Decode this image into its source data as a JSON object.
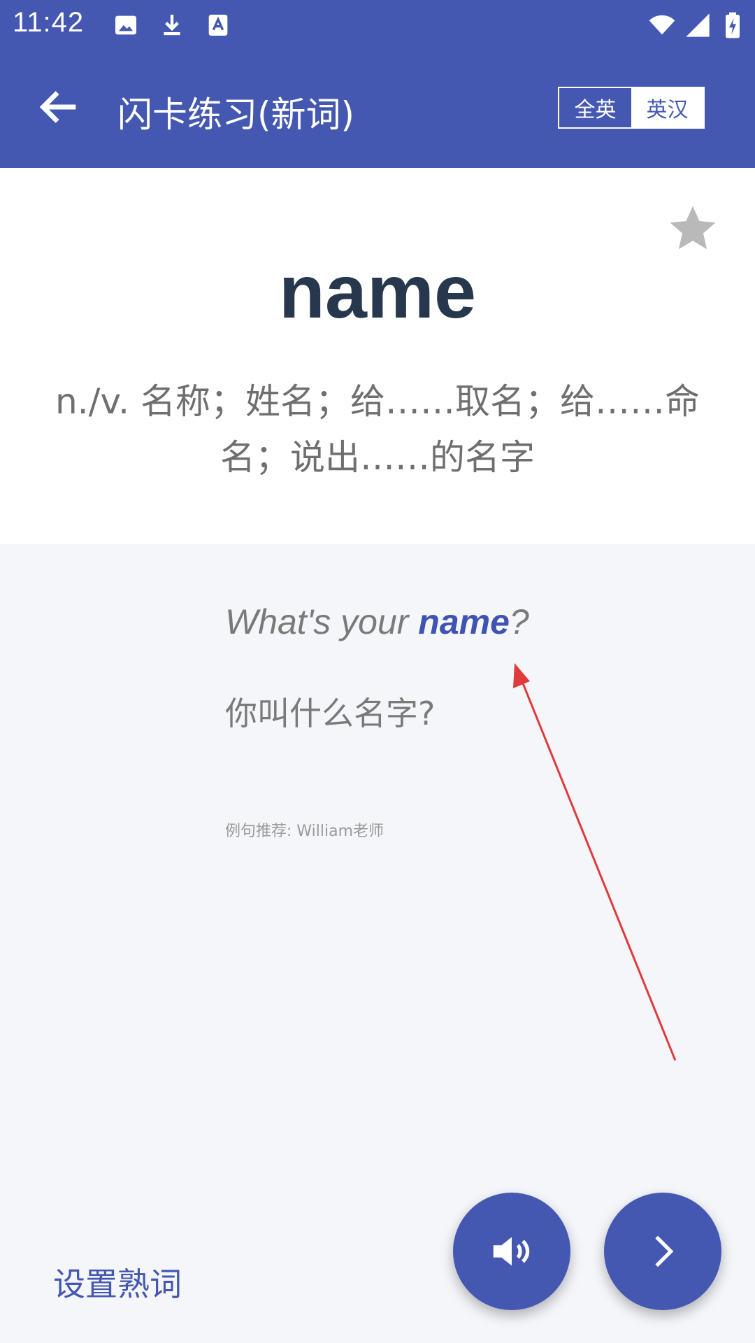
{
  "status_bar": {
    "time": "11:42"
  },
  "app_bar": {
    "title": "闪卡练习(新词)",
    "toggle": {
      "left_label": "全英",
      "right_label": "英汉",
      "selected": "英汉"
    }
  },
  "card": {
    "word": "name",
    "definition": "n./v. 名称；姓名；给……取名；给……命名；说出……的名字"
  },
  "example": {
    "sentence_before": "What's your ",
    "keyword": "name",
    "sentence_after": "?",
    "translation": "你叫什么名字?",
    "credit": "例句推荐: William老师"
  },
  "bottom": {
    "set_known_label": "设置熟词"
  },
  "colors": {
    "primary": "#4458b2",
    "word": "#27384e",
    "annotation_arrow": "#e03a3a"
  },
  "icons": {
    "back": "arrow-left",
    "favorite": "star",
    "sound": "speaker",
    "next": "chevron-right"
  }
}
